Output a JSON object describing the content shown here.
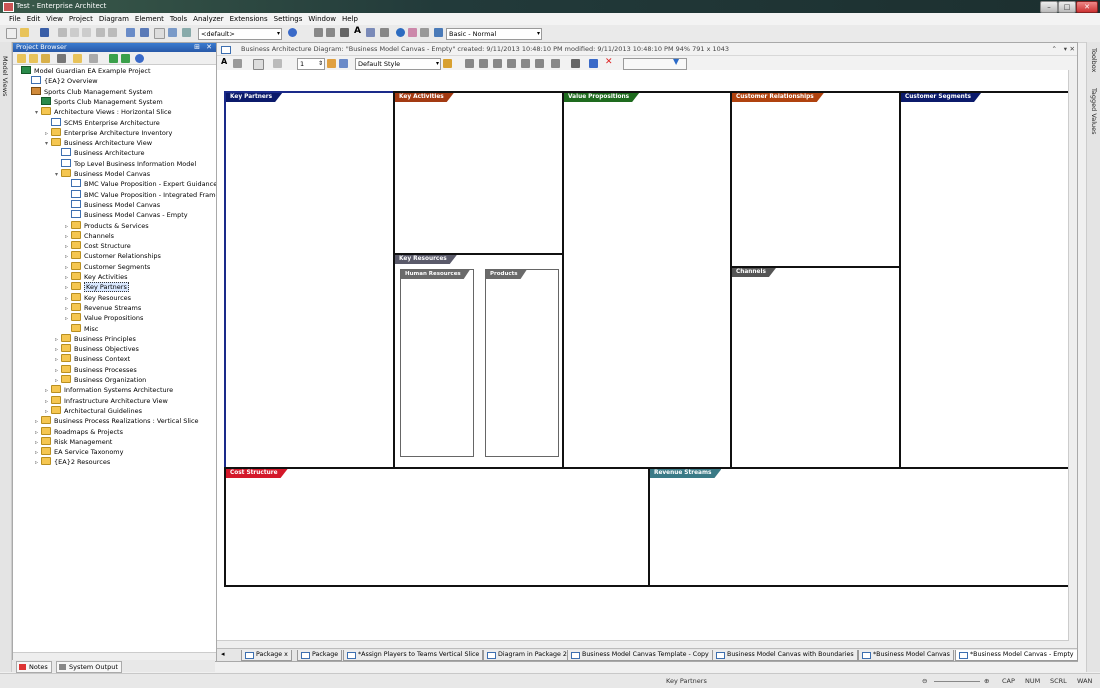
{
  "window": {
    "title": "Test - Enterprise Architect"
  },
  "menu": [
    "File",
    "Edit",
    "View",
    "Project",
    "Diagram",
    "Element",
    "Tools",
    "Analyzer",
    "Extensions",
    "Settings",
    "Window",
    "Help"
  ],
  "toolbar": {
    "perspective_value": "<default>",
    "workspace_value": "Basic - Normal"
  },
  "side_tabs": {
    "left": "Model Views",
    "right_top": "Toolbox",
    "right_second": "Tagged Values"
  },
  "browser": {
    "title": "Project Browser",
    "tree": [
      {
        "label": "Model Guardian EA Example Project",
        "level": 0,
        "icon": "model"
      },
      {
        "label": "{EA}2 Overview",
        "level": 1,
        "icon": "diagram"
      },
      {
        "label": "Sports Club Management System",
        "level": 1,
        "icon": "package"
      },
      {
        "label": "Sports Club Management System",
        "level": 2,
        "icon": "model"
      },
      {
        "label": "Architecture Views : Horizontal Slice",
        "level": 2,
        "icon": "folder",
        "exp": "▾"
      },
      {
        "label": "SCMS Enterprise Architecture",
        "level": 3,
        "icon": "diagram"
      },
      {
        "label": "Enterprise Architecture Inventory",
        "level": 3,
        "icon": "folder",
        "exp": "▹"
      },
      {
        "label": "Business Architecture View",
        "level": 3,
        "icon": "folder",
        "exp": "▾"
      },
      {
        "label": "Business Architecture",
        "level": 4,
        "icon": "diagram"
      },
      {
        "label": "Top Level Business Information Model",
        "level": 4,
        "icon": "diagram"
      },
      {
        "label": "Business Model Canvas",
        "level": 4,
        "icon": "folder",
        "exp": "▾"
      },
      {
        "label": "BMC Value Proposition - Expert Guidance",
        "level": 5,
        "icon": "diagram"
      },
      {
        "label": "BMC Value Proposition - Integrated Framework",
        "level": 5,
        "icon": "diagram"
      },
      {
        "label": "Business Model Canvas",
        "level": 5,
        "icon": "diagram"
      },
      {
        "label": "Business Model Canvas - Empty",
        "level": 5,
        "icon": "diagram"
      },
      {
        "label": "Products & Services",
        "level": 5,
        "icon": "folder",
        "exp": "▹"
      },
      {
        "label": "Channels",
        "level": 5,
        "icon": "folder",
        "exp": "▹"
      },
      {
        "label": "Cost Structure",
        "level": 5,
        "icon": "folder",
        "exp": "▹"
      },
      {
        "label": "Customer Relationships",
        "level": 5,
        "icon": "folder",
        "exp": "▹"
      },
      {
        "label": "Customer Segments",
        "level": 5,
        "icon": "folder",
        "exp": "▹"
      },
      {
        "label": "Key Activities",
        "level": 5,
        "icon": "folder",
        "exp": "▹"
      },
      {
        "label": "Key Partners",
        "level": 5,
        "icon": "folder",
        "exp": "▹",
        "selected": true
      },
      {
        "label": "Key Resources",
        "level": 5,
        "icon": "folder",
        "exp": "▹"
      },
      {
        "label": "Revenue Streams",
        "level": 5,
        "icon": "folder",
        "exp": "▹"
      },
      {
        "label": "Value Propositions",
        "level": 5,
        "icon": "folder",
        "exp": "▹"
      },
      {
        "label": "Misc",
        "level": 5,
        "icon": "folder"
      },
      {
        "label": "Business Principles",
        "level": 4,
        "icon": "folder",
        "exp": "▹"
      },
      {
        "label": "Business Objectives",
        "level": 4,
        "icon": "folder",
        "exp": "▹"
      },
      {
        "label": "Business Context",
        "level": 4,
        "icon": "folder",
        "exp": "▹"
      },
      {
        "label": "Business Processes",
        "level": 4,
        "icon": "folder",
        "exp": "▹"
      },
      {
        "label": "Business Organization",
        "level": 4,
        "icon": "folder",
        "exp": "▹"
      },
      {
        "label": "Information Systems Architecture",
        "level": 3,
        "icon": "folder",
        "exp": "▹"
      },
      {
        "label": "Infrastructure Architecture View",
        "level": 3,
        "icon": "folder",
        "exp": "▹"
      },
      {
        "label": "Architectural Guidelines",
        "level": 3,
        "icon": "folder",
        "exp": "▹"
      },
      {
        "label": "Business Process Realizations : Vertical Slice",
        "level": 2,
        "icon": "folder",
        "exp": "▹"
      },
      {
        "label": "Roadmaps & Projects",
        "level": 2,
        "icon": "folder",
        "exp": "▹"
      },
      {
        "label": "Risk Management",
        "level": 2,
        "icon": "folder",
        "exp": "▹"
      },
      {
        "label": "EA Service Taxonomy",
        "level": 2,
        "icon": "folder",
        "exp": "▹"
      },
      {
        "label": "{EA}2  Resources",
        "level": 2,
        "icon": "folder",
        "exp": "▹"
      }
    ]
  },
  "bottom_left_tabs": [
    "Notes",
    "System Output"
  ],
  "diagram": {
    "header": "Business Architecture Diagram: \"Business Model Canvas - Empty\"  created: 9/11/2013 10:48:10 PM  modified: 9/11/2013 10:48:10 PM   94%   791 x 1043",
    "line_width_value": "1",
    "style_value": "Default Style",
    "canvas": {
      "key_partners": {
        "label": "Key Partners",
        "color": "#0b1a6b"
      },
      "key_activities": {
        "label": "Key Activities",
        "color": "#a33a12"
      },
      "key_resources": {
        "label": "Key Resources",
        "color": "#5a5a6a"
      },
      "human_resources": {
        "label": "Human Resources"
      },
      "products": {
        "label": "Products"
      },
      "value_propositions": {
        "label": "Value Propositions",
        "color": "#1e6b1e"
      },
      "customer_relationships": {
        "label": "Customer Relationships",
        "color": "#b0420e"
      },
      "channels": {
        "label": "Channels",
        "color": "#555555"
      },
      "customer_segments": {
        "label": "Customer Segments",
        "color": "#0b1a6b"
      },
      "cost_structure": {
        "label": "Cost Structure",
        "color": "#d4182a"
      },
      "revenue_streams": {
        "label": "Revenue Streams",
        "color": "#3a7a86"
      }
    },
    "tabs": [
      "Package x",
      "Package",
      "*Assign Players to Teams Vertical Slice",
      "Diagram in Package 2",
      "Business Model Canvas Template - Copy",
      "Business Model Canvas with Boundaries",
      "*Business Model Canvas",
      "*Business Model Canvas - Empty"
    ]
  },
  "status": {
    "selection": "Key Partners",
    "indicators": [
      "CAP",
      "NUM",
      "SCRL",
      "WAN"
    ]
  }
}
